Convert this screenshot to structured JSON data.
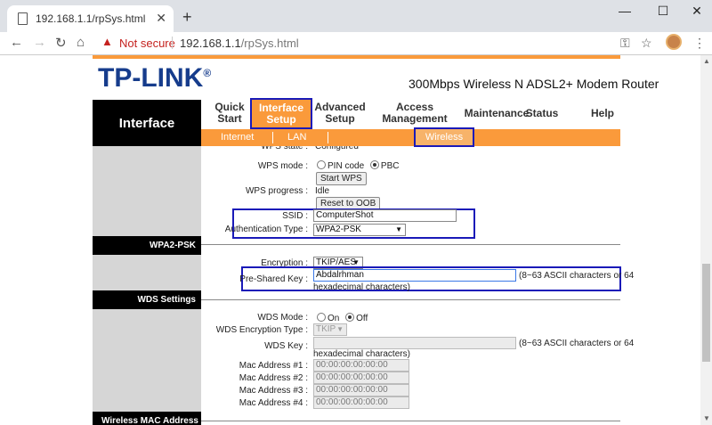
{
  "browser": {
    "tab_title": "192.168.1.1/rpSys.html",
    "url_host": "192.168.1.1",
    "url_path": "/rpSys.html",
    "security_label": "Not secure"
  },
  "header": {
    "logo": "TP-LINK",
    "model": "300Mbps Wireless N ADSL2+ Modem Router"
  },
  "nav": {
    "section_title": "Interface",
    "menu": [
      {
        "label": "Quick\nStart"
      },
      {
        "label": "Interface\nSetup"
      },
      {
        "label": "Advanced\nSetup"
      },
      {
        "label": "Access\nManagement"
      },
      {
        "label": "Maintenance"
      },
      {
        "label": "Status"
      },
      {
        "label": "Help"
      }
    ],
    "submenu": [
      "Internet",
      "LAN",
      "Wireless"
    ]
  },
  "wps": {
    "state_label": "WPS state :",
    "state_value": "Configured",
    "mode_label": "WPS mode :",
    "mode_opt1": "PIN code",
    "mode_opt2": "PBC",
    "start_button": "Start WPS",
    "progress_label": "WPS progress :",
    "progress_value": "Idle",
    "reset_button": "Reset to OOB",
    "ssid_label": "SSID :",
    "ssid_value": "ComputerShot",
    "auth_label": "Authentication Type :",
    "auth_value": "WPA2-PSK"
  },
  "wpa2": {
    "section": "WPA2-PSK",
    "encryption_label": "Encryption :",
    "encryption_value": "TKIP/AES",
    "psk_label": "Pre-Shared Key :",
    "psk_value": "Abdalrhman",
    "psk_hint1": "(8~63 ASCII characters or 64",
    "psk_hint2": "hexadecimal characters)"
  },
  "wds": {
    "section": "WDS Settings",
    "mode_label": "WDS Mode :",
    "mode_on": "On",
    "mode_off": "Off",
    "enc_label": "WDS Encryption Type :",
    "enc_value": "TKIP",
    "key_label": "WDS Key :",
    "key_hint1": "(8~63 ASCII characters or 64",
    "key_hint2": "hexadecimal characters)",
    "mac": [
      {
        "label": "Mac Address #1 :",
        "value": "00:00:00:00:00:00"
      },
      {
        "label": "Mac Address #2 :",
        "value": "00:00:00:00:00:00"
      },
      {
        "label": "Mac Address #3 :",
        "value": "00:00:00:00:00:00"
      },
      {
        "label": "Mac Address #4 :",
        "value": "00:00:00:00:00:00"
      }
    ]
  },
  "mac_filter": {
    "section": "Wireless MAC Address Filter"
  }
}
